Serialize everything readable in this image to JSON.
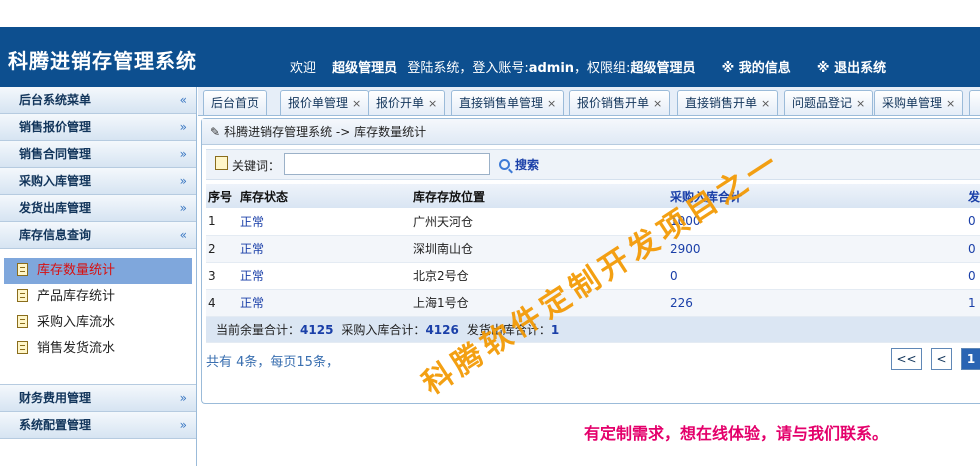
{
  "header": {
    "app_title": "科腾进销存管理系统",
    "welcome": "欢迎",
    "user_name": "超级管理员",
    "login_text": "登陆系统，登入账号:",
    "account": "admin",
    "role_text": "，权限组:",
    "role": "超级管理员",
    "my_info": "※ 我的信息",
    "logout": "※ 退出系统"
  },
  "sidebar": {
    "title": "后台系统菜单",
    "title_chevron": "«",
    "chevron": "»",
    "chevron_up": "«",
    "menus_top": [
      "销售报价管理",
      "销售合同管理",
      "采购入库管理",
      "发货出库管理"
    ],
    "open_menu": "库存信息查询",
    "sub_items": [
      "库存数量统计",
      "产品库存统计",
      "采购入库流水",
      "销售发货流水"
    ],
    "menus_bottom": [
      "财务费用管理",
      "系统配置管理"
    ]
  },
  "tabs": [
    {
      "label": "后台首页",
      "closable": false
    },
    {
      "label": "报价单管理",
      "closable": true
    },
    {
      "label": "报价开单",
      "closable": true
    },
    {
      "label": "直接销售单管理",
      "closable": true
    },
    {
      "label": "报价销售开单",
      "closable": true
    },
    {
      "label": "直接销售开单",
      "closable": true
    },
    {
      "label": "问题品登记",
      "closable": true
    },
    {
      "label": "采购单管理",
      "closable": true
    }
  ],
  "tab_close": "×",
  "breadcrumb": "科腾进销存管理系统 -> 库存数量统计",
  "search": {
    "label": "关键词：",
    "placeholder": "",
    "button": "搜索"
  },
  "table": {
    "headers": [
      "序号",
      "库存状态",
      "库存存放位置",
      "采购入库合计",
      "发"
    ],
    "rows": [
      [
        "1",
        "正常",
        "广州天河仓",
        "1000",
        "0"
      ],
      [
        "2",
        "正常",
        "深圳南山仓",
        "2900",
        "0"
      ],
      [
        "3",
        "正常",
        "北京2号仓",
        "0",
        "0"
      ],
      [
        "4",
        "正常",
        "上海1号仓",
        "226",
        "1"
      ]
    ],
    "totals": {
      "remain_label": "当前余量合计：",
      "remain_value": "4125",
      "purchase_label": "采购入库合计：",
      "purchase_value": "4126",
      "ship_label": "发货出库合计：",
      "ship_value": "1"
    }
  },
  "pager": {
    "info": "共有 4条，每页15条，",
    "first": "<<",
    "prev": "<",
    "current": "1"
  },
  "watermark": "科腾软件定制开发项目之一",
  "contact": "有定制需求，想在线体验，请与我们联系。",
  "colors": {
    "header_bg": "#0d4f8f",
    "active_item_bg": "#7fa7dc",
    "active_item_text": "#d81010",
    "link_blue": "#1a3fa8",
    "watermark": "#f39800",
    "contact": "#e4006b"
  }
}
